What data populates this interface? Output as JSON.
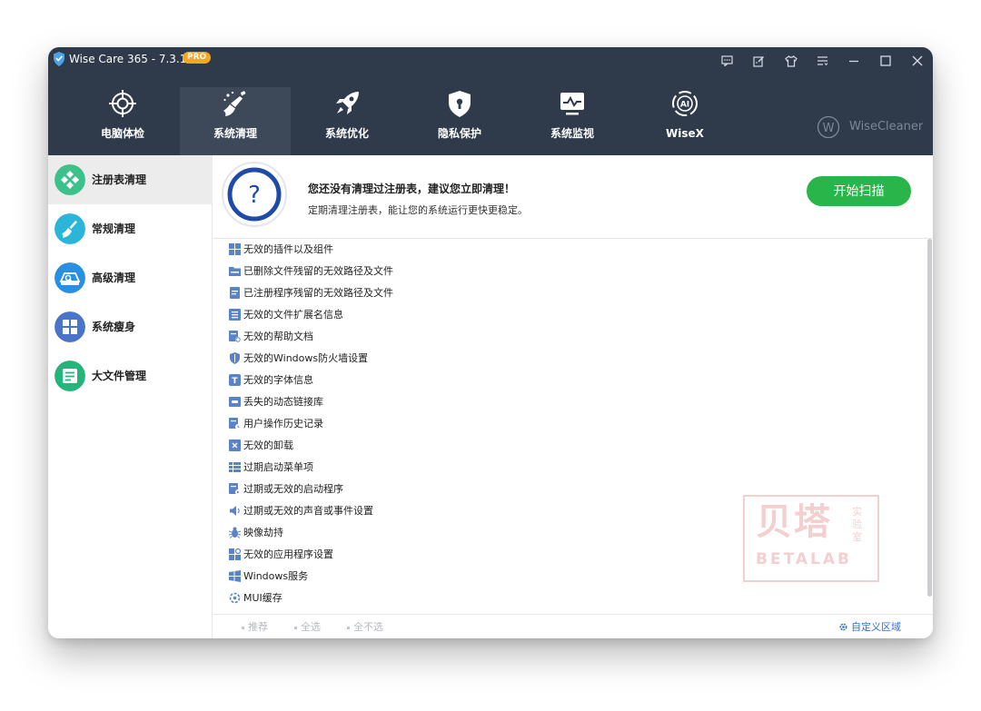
{
  "window": {
    "title": "Wise Care 365 - 7.3.1",
    "badge": "PRO",
    "controls": [
      "feedback-icon",
      "edit-icon",
      "skin-icon",
      "menu-icon",
      "minimize-icon",
      "maximize-icon",
      "close-icon"
    ]
  },
  "tabs": [
    {
      "label": "电脑体检",
      "icon": "target-icon",
      "active": false
    },
    {
      "label": "系统清理",
      "icon": "broom-icon",
      "active": true
    },
    {
      "label": "系统优化",
      "icon": "rocket-icon",
      "active": false
    },
    {
      "label": "隐私保护",
      "icon": "shield-lock-icon",
      "active": false
    },
    {
      "label": "系统监视",
      "icon": "monitor-icon",
      "active": false
    },
    {
      "label": "WiseX",
      "icon": "ai-icon",
      "active": false
    }
  ],
  "brand": {
    "text": "WiseCleaner",
    "mark": "W"
  },
  "sidebar": {
    "items": [
      {
        "label": "注册表清理",
        "icon": "registry-icon",
        "color": "#3cc18a",
        "active": true
      },
      {
        "label": "常规清理",
        "icon": "broom-icon",
        "color": "#2bb5d8",
        "active": false
      },
      {
        "label": "高级清理",
        "icon": "disk-icon",
        "color": "#2a8fe0",
        "active": false
      },
      {
        "label": "系统瘦身",
        "icon": "windows-icon",
        "color": "#4a74c9",
        "active": false
      },
      {
        "label": "大文件管理",
        "icon": "file-list-icon",
        "color": "#25b57a",
        "active": false
      }
    ]
  },
  "status": {
    "title": "您还没有清理过注册表，建议您立即清理！",
    "description": "定期清理注册表，能让您的系统运行更快更稳定。",
    "icon": "question-icon",
    "scan_button": "开始扫描"
  },
  "items": [
    "无效的插件以及组件",
    "已删除文件残留的无效路径及文件",
    "已注册程序残留的无效路径及文件",
    "无效的文件扩展名信息",
    "无效的帮助文档",
    "无效的Windows防火墙设置",
    "无效的字体信息",
    "丢失的动态链接库",
    "用户操作历史记录",
    "无效的卸载",
    "过期启动菜单项",
    "过期或无效的启动程序",
    "过期或无效的声音或事件设置",
    "映像劫持",
    "无效的应用程序设置",
    "Windows服务",
    "MUI缓存"
  ],
  "bottom": {
    "recommend": "推荐",
    "select_all": "全选",
    "select_none": "全不选",
    "custom_area": "自定义区域"
  },
  "watermark": {
    "main": "贝塔",
    "sub": "BETALAB",
    "side": "实验室"
  }
}
